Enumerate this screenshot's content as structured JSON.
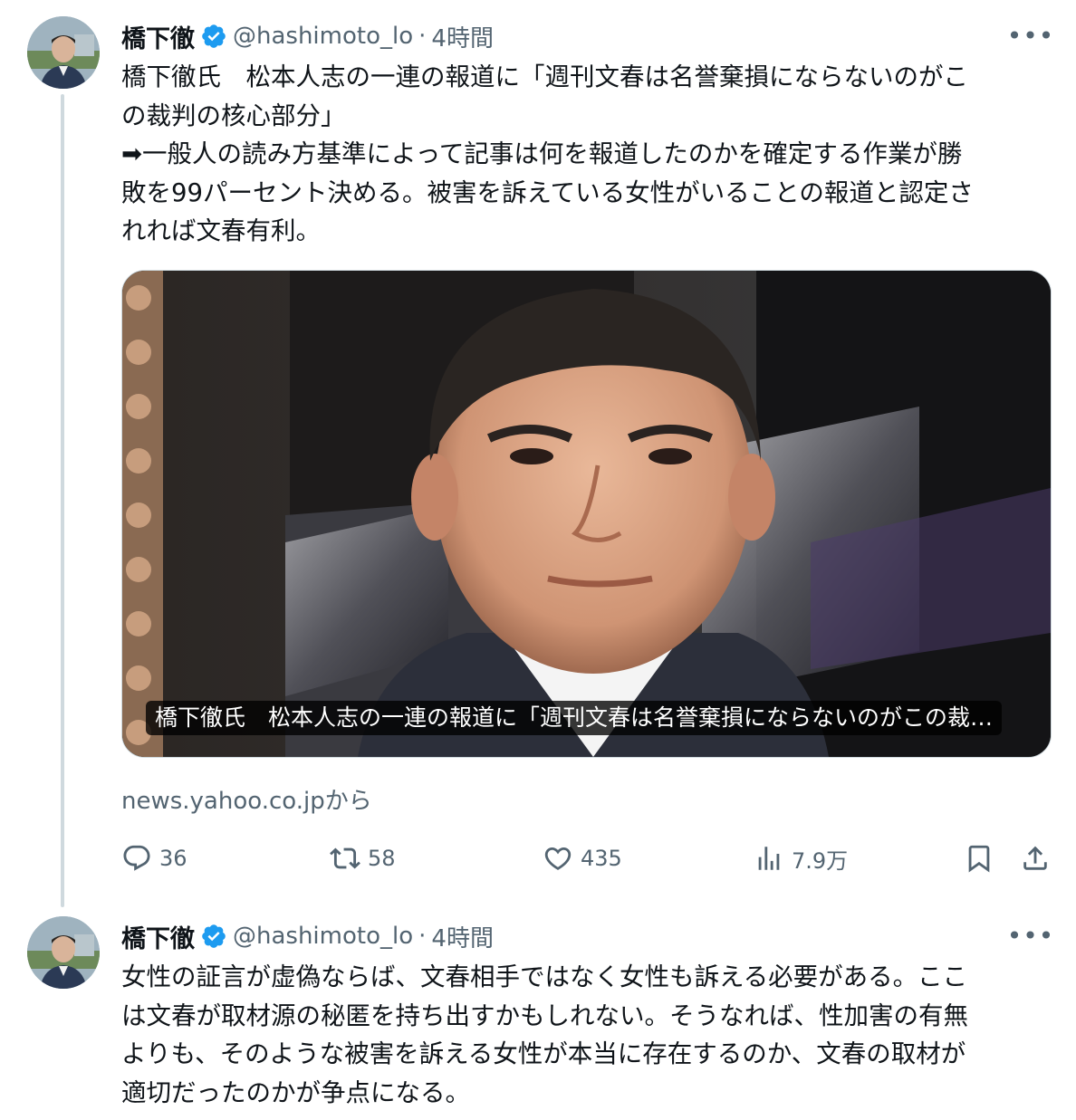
{
  "tweets": [
    {
      "author_name": "橋下徹",
      "handle": "@hashimoto_lo",
      "separator": "·",
      "time": "4時間",
      "more_label": "•••",
      "text_lines": [
        "橋下徹氏　松本人志の一連の報道に「週刊文春は名誉棄損にならないのがこ",
        "の裁判の核心部分」",
        "➡一般人の読み方基準によって記事は何を報道したのかを確定する作業が勝",
        "敗を99パーセント決める。被害を訴えている女性がいることの報道と認定さ",
        "れれば文春有利。"
      ],
      "media_caption": "橋下徹氏　松本人志の一連の報道に「週刊文春は名誉棄損にならないのがこの裁…",
      "source": "news.yahoo.co.jpから",
      "replies": "36",
      "reposts": "58",
      "likes": "435",
      "views": "7.9万"
    },
    {
      "author_name": "橋下徹",
      "handle": "@hashimoto_lo",
      "separator": "·",
      "time": "4時間",
      "more_label": "•••",
      "text_lines": [
        "女性の証言が虚偽ならば、文春相手ではなく女性も訴える必要がある。ここ",
        "は文春が取材源の秘匿を持ち出すかもしれない。そうなれば、性加害の有無",
        "よりも、そのような被害を訴える女性が本当に存在するのか、文春の取材が",
        "適切だったのかが争点になる。"
      ]
    }
  ],
  "colors": {
    "verified": "#1d9bf0",
    "secondary_text": "#536471",
    "thread_line": "#cfd9de"
  },
  "icons": [
    "reply-icon",
    "repost-icon",
    "like-icon",
    "views-icon",
    "bookmark-icon",
    "share-icon",
    "verified-badge-icon"
  ]
}
